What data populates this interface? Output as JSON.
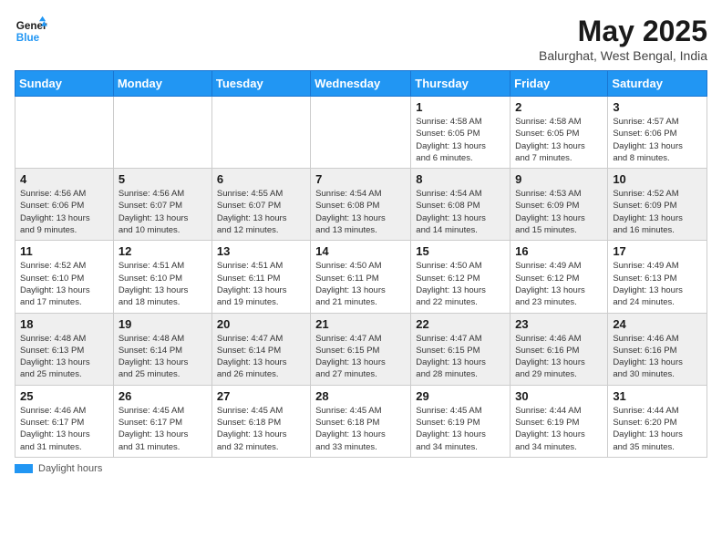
{
  "header": {
    "logo_line1": "General",
    "logo_line2": "Blue",
    "month_title": "May 2025",
    "location": "Balurghat, West Bengal, India"
  },
  "days_of_week": [
    "Sunday",
    "Monday",
    "Tuesday",
    "Wednesday",
    "Thursday",
    "Friday",
    "Saturday"
  ],
  "footer": {
    "daylight_label": "Daylight hours"
  },
  "weeks": [
    [
      {
        "day": "",
        "info": ""
      },
      {
        "day": "",
        "info": ""
      },
      {
        "day": "",
        "info": ""
      },
      {
        "day": "",
        "info": ""
      },
      {
        "day": "1",
        "info": "Sunrise: 4:58 AM\nSunset: 6:05 PM\nDaylight: 13 hours\nand 6 minutes."
      },
      {
        "day": "2",
        "info": "Sunrise: 4:58 AM\nSunset: 6:05 PM\nDaylight: 13 hours\nand 7 minutes."
      },
      {
        "day": "3",
        "info": "Sunrise: 4:57 AM\nSunset: 6:06 PM\nDaylight: 13 hours\nand 8 minutes."
      }
    ],
    [
      {
        "day": "4",
        "info": "Sunrise: 4:56 AM\nSunset: 6:06 PM\nDaylight: 13 hours\nand 9 minutes."
      },
      {
        "day": "5",
        "info": "Sunrise: 4:56 AM\nSunset: 6:07 PM\nDaylight: 13 hours\nand 10 minutes."
      },
      {
        "day": "6",
        "info": "Sunrise: 4:55 AM\nSunset: 6:07 PM\nDaylight: 13 hours\nand 12 minutes."
      },
      {
        "day": "7",
        "info": "Sunrise: 4:54 AM\nSunset: 6:08 PM\nDaylight: 13 hours\nand 13 minutes."
      },
      {
        "day": "8",
        "info": "Sunrise: 4:54 AM\nSunset: 6:08 PM\nDaylight: 13 hours\nand 14 minutes."
      },
      {
        "day": "9",
        "info": "Sunrise: 4:53 AM\nSunset: 6:09 PM\nDaylight: 13 hours\nand 15 minutes."
      },
      {
        "day": "10",
        "info": "Sunrise: 4:52 AM\nSunset: 6:09 PM\nDaylight: 13 hours\nand 16 minutes."
      }
    ],
    [
      {
        "day": "11",
        "info": "Sunrise: 4:52 AM\nSunset: 6:10 PM\nDaylight: 13 hours\nand 17 minutes."
      },
      {
        "day": "12",
        "info": "Sunrise: 4:51 AM\nSunset: 6:10 PM\nDaylight: 13 hours\nand 18 minutes."
      },
      {
        "day": "13",
        "info": "Sunrise: 4:51 AM\nSunset: 6:11 PM\nDaylight: 13 hours\nand 19 minutes."
      },
      {
        "day": "14",
        "info": "Sunrise: 4:50 AM\nSunset: 6:11 PM\nDaylight: 13 hours\nand 21 minutes."
      },
      {
        "day": "15",
        "info": "Sunrise: 4:50 AM\nSunset: 6:12 PM\nDaylight: 13 hours\nand 22 minutes."
      },
      {
        "day": "16",
        "info": "Sunrise: 4:49 AM\nSunset: 6:12 PM\nDaylight: 13 hours\nand 23 minutes."
      },
      {
        "day": "17",
        "info": "Sunrise: 4:49 AM\nSunset: 6:13 PM\nDaylight: 13 hours\nand 24 minutes."
      }
    ],
    [
      {
        "day": "18",
        "info": "Sunrise: 4:48 AM\nSunset: 6:13 PM\nDaylight: 13 hours\nand 25 minutes."
      },
      {
        "day": "19",
        "info": "Sunrise: 4:48 AM\nSunset: 6:14 PM\nDaylight: 13 hours\nand 25 minutes."
      },
      {
        "day": "20",
        "info": "Sunrise: 4:47 AM\nSunset: 6:14 PM\nDaylight: 13 hours\nand 26 minutes."
      },
      {
        "day": "21",
        "info": "Sunrise: 4:47 AM\nSunset: 6:15 PM\nDaylight: 13 hours\nand 27 minutes."
      },
      {
        "day": "22",
        "info": "Sunrise: 4:47 AM\nSunset: 6:15 PM\nDaylight: 13 hours\nand 28 minutes."
      },
      {
        "day": "23",
        "info": "Sunrise: 4:46 AM\nSunset: 6:16 PM\nDaylight: 13 hours\nand 29 minutes."
      },
      {
        "day": "24",
        "info": "Sunrise: 4:46 AM\nSunset: 6:16 PM\nDaylight: 13 hours\nand 30 minutes."
      }
    ],
    [
      {
        "day": "25",
        "info": "Sunrise: 4:46 AM\nSunset: 6:17 PM\nDaylight: 13 hours\nand 31 minutes."
      },
      {
        "day": "26",
        "info": "Sunrise: 4:45 AM\nSunset: 6:17 PM\nDaylight: 13 hours\nand 31 minutes."
      },
      {
        "day": "27",
        "info": "Sunrise: 4:45 AM\nSunset: 6:18 PM\nDaylight: 13 hours\nand 32 minutes."
      },
      {
        "day": "28",
        "info": "Sunrise: 4:45 AM\nSunset: 6:18 PM\nDaylight: 13 hours\nand 33 minutes."
      },
      {
        "day": "29",
        "info": "Sunrise: 4:45 AM\nSunset: 6:19 PM\nDaylight: 13 hours\nand 34 minutes."
      },
      {
        "day": "30",
        "info": "Sunrise: 4:44 AM\nSunset: 6:19 PM\nDaylight: 13 hours\nand 34 minutes."
      },
      {
        "day": "31",
        "info": "Sunrise: 4:44 AM\nSunset: 6:20 PM\nDaylight: 13 hours\nand 35 minutes."
      }
    ]
  ]
}
